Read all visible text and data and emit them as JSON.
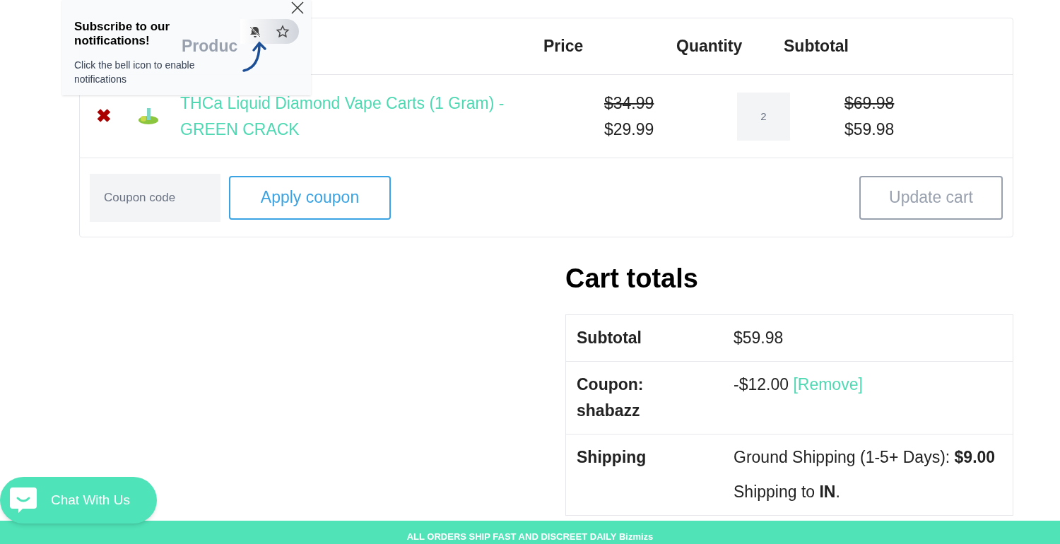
{
  "popup": {
    "title": "Subscribe to our notifications!",
    "text": "Click the bell icon to enable notifications"
  },
  "cart_table": {
    "columns": [
      "Produc",
      "Price",
      "Quantity",
      "Subtotal"
    ],
    "rows": [
      {
        "remove": "✖",
        "product": "THCa Liquid Diamond Vape Carts (1 Gram) - GREEN CRACK",
        "old_price": "$34.99",
        "price": "$29.99",
        "quantity": "2",
        "old_subtotal": "$69.98",
        "subtotal": "$59.98"
      }
    ],
    "coupon_placeholder": "Coupon code",
    "apply_button": "Apply coupon",
    "update_button": "Update cart"
  },
  "cart_totals": {
    "title": "Cart totals",
    "rows": [
      {
        "kind": "plain",
        "label": "Subtotal",
        "value": "$59.98"
      },
      {
        "kind": "coupon",
        "label": "Coupon: shabazz",
        "value": "-$12.00",
        "link": "[Remove]"
      },
      {
        "kind": "shipping",
        "label": "Shipping",
        "value": "Ground Shipping (1-5+ Days): **$9.00**",
        "note": "Shipping to **IN**."
      }
    ]
  },
  "chat_button": "Chat With Us",
  "banner": "ALL ORDERS SHIP FAST AND DISCREET DAILY Bizmizs"
}
